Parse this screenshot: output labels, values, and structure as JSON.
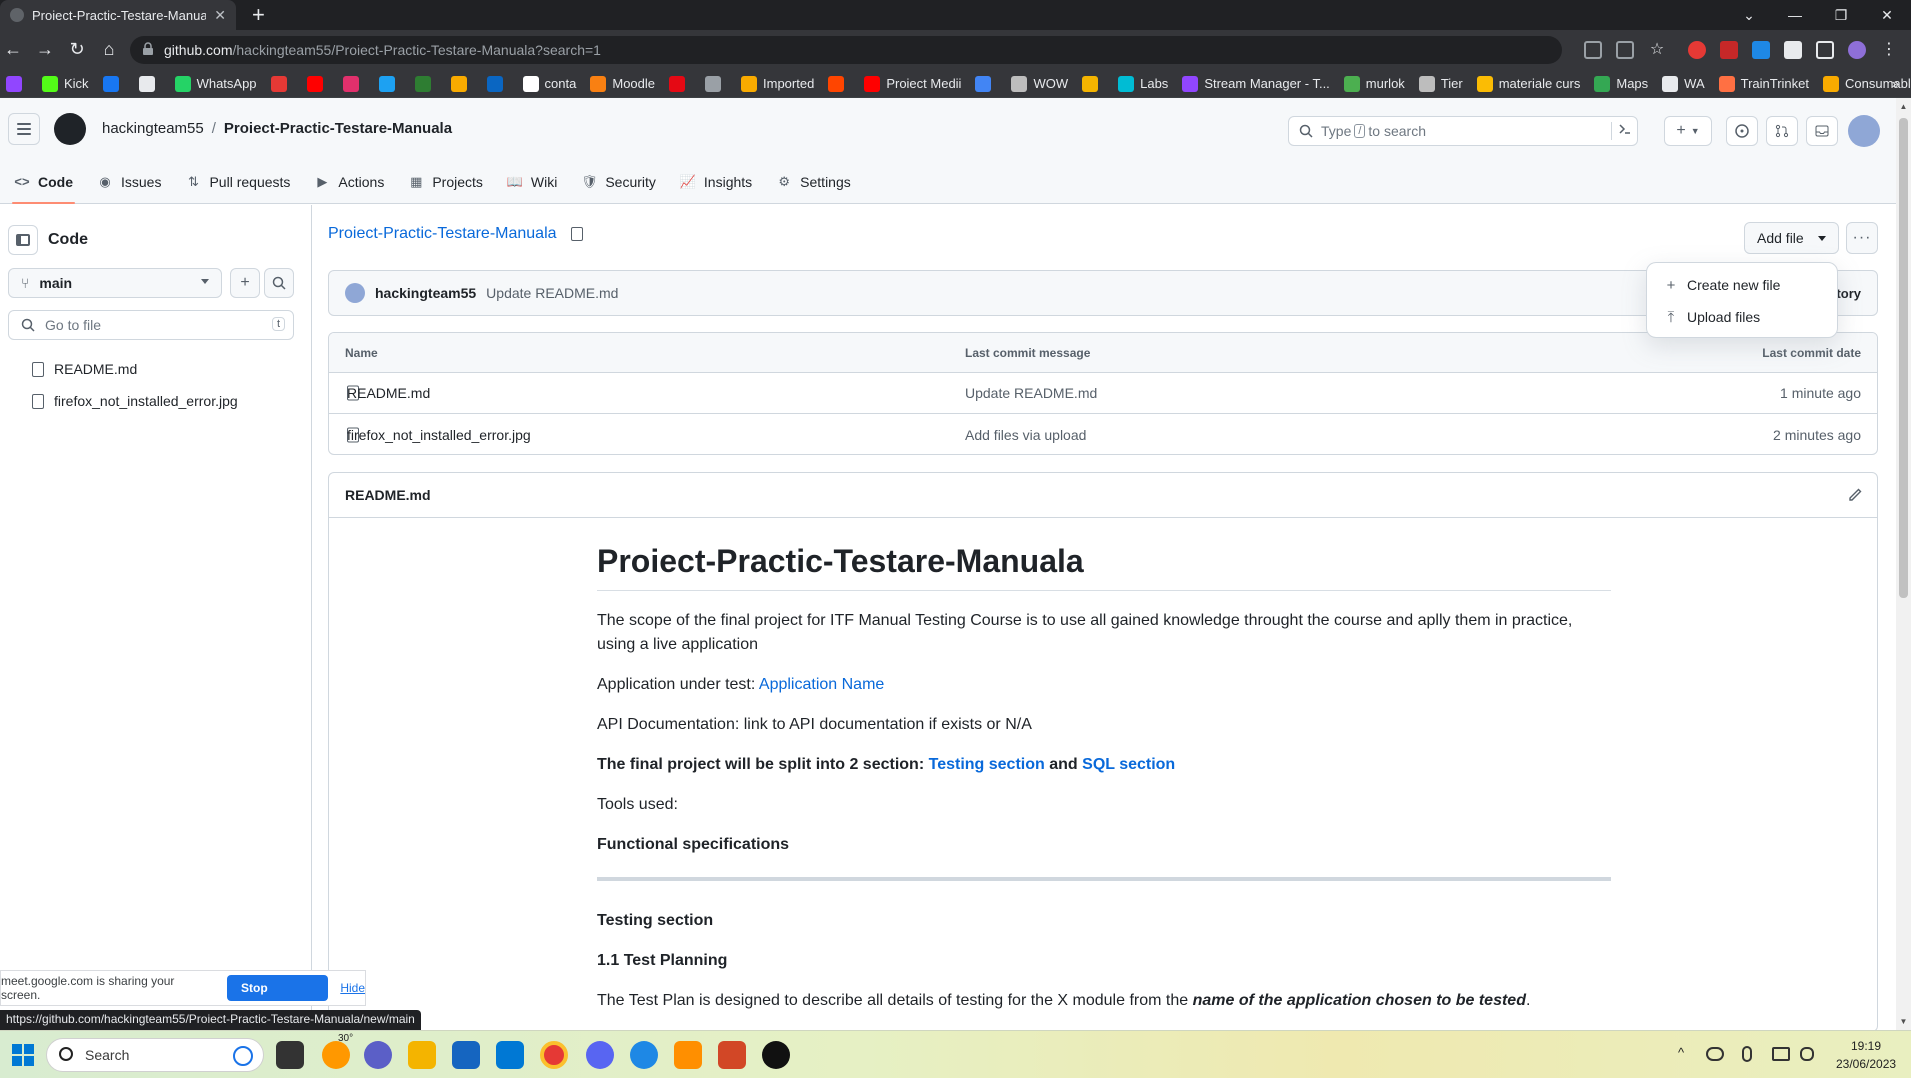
{
  "browser": {
    "tab_title": "Proiect-Practic-Testare-Manuala/",
    "tab_close": "✕",
    "new_tab": "+",
    "window_controls": [
      "⌄",
      "—",
      "❐",
      "✕"
    ],
    "url_host": "github.com",
    "url_path": "/hackingteam55/Proiect-Practic-Testare-Manuala?search=1",
    "nav": [
      "←",
      "→",
      "↻",
      "⌂"
    ],
    "bookmarks": [
      {
        "label": "",
        "color": "#9146ff"
      },
      {
        "label": "Kick",
        "color": "#53fc18"
      },
      {
        "label": "",
        "color": "#1877f2"
      },
      {
        "label": "",
        "color": "#e8eaed"
      },
      {
        "label": "WhatsApp",
        "color": "#25d366"
      },
      {
        "label": "",
        "color": "#e53935"
      },
      {
        "label": "",
        "color": "#ff0000"
      },
      {
        "label": "",
        "color": "#e1306c"
      },
      {
        "label": "",
        "color": "#1da1f2"
      },
      {
        "label": "",
        "color": "#2e7d32"
      },
      {
        "label": "",
        "color": "#f9ab00"
      },
      {
        "label": "",
        "color": "#0a66c2"
      },
      {
        "label": "conta",
        "color": "#ffffff"
      },
      {
        "label": "Moodle",
        "color": "#f98012"
      },
      {
        "label": "",
        "color": "#e50914"
      },
      {
        "label": "",
        "color": "#9aa0a6"
      },
      {
        "label": "Imported",
        "color": "#f9ab00"
      },
      {
        "label": "",
        "color": "#ff4500"
      },
      {
        "label": "Proiect Medii",
        "color": "#ff0000"
      },
      {
        "label": "",
        "color": "#4285f4"
      },
      {
        "label": "WOW",
        "color": "#bdbdbd"
      },
      {
        "label": "",
        "color": "#f4b400"
      },
      {
        "label": "Labs",
        "color": "#00bcd4"
      },
      {
        "label": "Stream Manager - T...",
        "color": "#9146ff"
      },
      {
        "label": "murlok",
        "color": "#4caf50"
      },
      {
        "label": "Tier",
        "color": "#bdbdbd"
      },
      {
        "label": "materiale curs",
        "color": "#fbbc04"
      },
      {
        "label": "Maps",
        "color": "#34a853"
      },
      {
        "label": "WA",
        "color": "#e8eaed"
      },
      {
        "label": "TrainTrinket",
        "color": "#ff7043"
      },
      {
        "label": "Consumables",
        "color": "#f9ab00"
      }
    ],
    "bookmarks_more": "»"
  },
  "github": {
    "owner": "hackingteam55",
    "repo": "Proiect-Practic-Testare-Manuala",
    "crumb_sep": "/",
    "search_prefix": "Type",
    "search_key": "/",
    "search_suffix": "to search",
    "header_plus": "+",
    "repo_nav": [
      {
        "label": "Code",
        "icon": "<>",
        "active": true
      },
      {
        "label": "Issues",
        "icon": "◉"
      },
      {
        "label": "Pull requests",
        "icon": "⇅"
      },
      {
        "label": "Actions",
        "icon": "▶"
      },
      {
        "label": "Projects",
        "icon": "▦"
      },
      {
        "label": "Wiki",
        "icon": "📖"
      },
      {
        "label": "Security",
        "icon": "🛡"
      },
      {
        "label": "Insights",
        "icon": "📈"
      },
      {
        "label": "Settings",
        "icon": "⚙"
      }
    ],
    "sidebar": {
      "title": "Code",
      "branch": "main",
      "plus": "+",
      "go_to_file": "Go to file",
      "go_to_file_key": "t",
      "files": [
        "README.md",
        "firefox_not_installed_error.jpg"
      ]
    },
    "main": {
      "title": "Proiect-Practic-Testare-Manuala",
      "add_file": "Add file",
      "more": "···",
      "commit_author": "hackingteam55",
      "commit_message": "Update README.md",
      "history_fragment": "tory",
      "table_headers": {
        "name": "Name",
        "commit": "Last commit message",
        "date": "Last commit date"
      },
      "rows": [
        {
          "name": "README.md",
          "commit": "Update README.md",
          "date": "1 minute ago"
        },
        {
          "name": "firefox_not_installed_error.jpg",
          "commit": "Add files via upload",
          "date": "2 minutes ago"
        }
      ],
      "dropdown": [
        {
          "label": "Create new file",
          "icon": "+"
        },
        {
          "label": "Upload files",
          "icon": "⤒"
        }
      ]
    },
    "readme": {
      "filename": "README.md",
      "h1": "Proiect-Practic-Testare-Manuala",
      "p1": "The scope of the final project for ITF Manual Testing Course is to use all gained knowledge throught the course and aplly them in practice, using a live application",
      "p2_prefix": "Application under test:",
      "p2_link": "Application Name",
      "p3": "API Documentation: link to API documentation if exists or N/A",
      "p4_prefix": "The final project will be split into 2 section:",
      "p4_link1": "Testing section",
      "p4_and": "and",
      "p4_link2": "SQL section",
      "p5": "Tools used:",
      "p6": "Functional specifications",
      "h_testing": "Testing section",
      "h_plan": "1.1 Test Planning",
      "p7_prefix": "The Test Plan is designed to describe all details of testing for the X module from the",
      "p7_em": "name of the application chosen to be tested",
      "p7_suffix": "."
    }
  },
  "overlay": {
    "share_text": "meet.google.com is sharing your screen.",
    "stop_sharing": "Stop sharing",
    "hide": "Hide",
    "status_url": "https://github.com/hackingteam55/Proiect-Practic-Testare-Manuala/new/main"
  },
  "taskbar": {
    "search": "Search",
    "weather": "30°",
    "time": "19:19",
    "date": "23/06/2023",
    "tray_caret": "^"
  }
}
